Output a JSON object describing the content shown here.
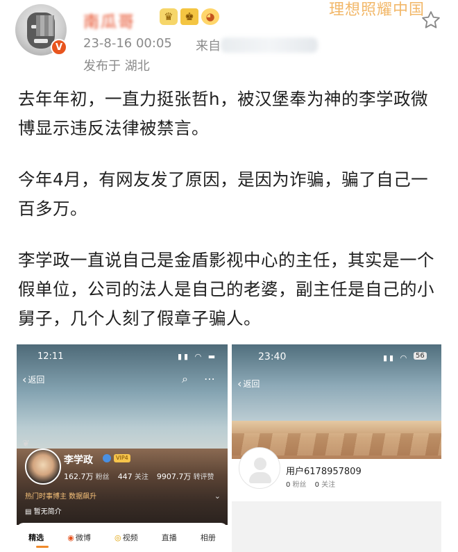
{
  "post": {
    "author": "南瓜哥",
    "timestamp": "23-8-16 00:05",
    "source_prefix": "来自",
    "location": "发布于 湖北",
    "watermark": "理想照耀中国",
    "icons": [
      "avatar",
      "verified-badge-icon",
      "crown-badge-icon",
      "fan-badge-icon",
      "emoji-badge-icon",
      "star-icon"
    ]
  },
  "content": {
    "paragraphs": [
      "去年年初，一直力挺张哲h，被汉堡奉为神的李学政微博显示违反法律被禁言。",
      "今年4月，有网友发了原因，是因为诈骗，骗了自己一百多万。",
      "李学政一直说自己是金盾影视中心的主任，其实是一个假单位，公司的法人是自己的老婆，副主任是自己的小舅子，几个人刻了假章子骗人。"
    ]
  },
  "screenshot_left": {
    "time": "12:11",
    "back_label": "返回",
    "profile_name": "李学政",
    "vip_tag": "VIP4",
    "followers_count": "162.7万",
    "followers_label": "粉丝",
    "following_count": "447",
    "following_label": "关注",
    "likes_count": "9907.7万",
    "likes_label": "转评赞",
    "hot_label": "热门时事博主 数据飙升",
    "intro": "暂无简介",
    "tabs": [
      "精选",
      "微博",
      "视频",
      "直播",
      "相册"
    ]
  },
  "screenshot_right": {
    "time": "23:40",
    "back_label": "返回",
    "battery": "56",
    "user_name": "用户6178957809",
    "fans_count": "0",
    "fans_label": "粉丝",
    "follow_count": "0",
    "follow_label": "关注"
  },
  "colors": {
    "author_name": "#e5461f",
    "meta_text": "#8a8a8a",
    "watermark": "#f2b768",
    "tab_accent": "#f08a2b"
  }
}
